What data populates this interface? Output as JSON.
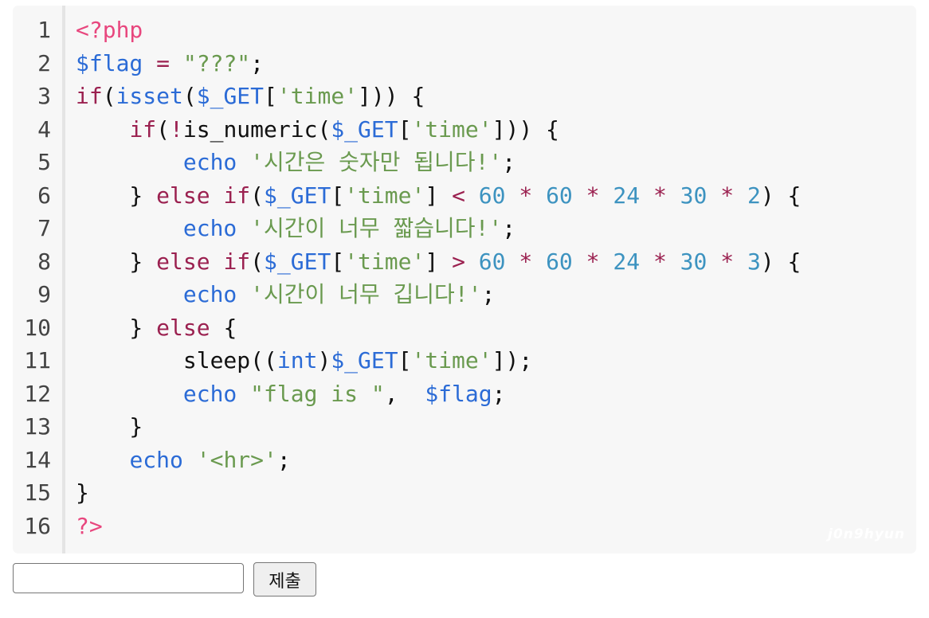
{
  "code": {
    "lines": [
      {
        "n": "1",
        "tokens": [
          {
            "c": "t-tag",
            "t": "<?php"
          }
        ]
      },
      {
        "n": "2",
        "tokens": [
          {
            "c": "t-var",
            "t": "$flag"
          },
          {
            "c": "t-plain",
            "t": " "
          },
          {
            "c": "t-op",
            "t": "="
          },
          {
            "c": "t-plain",
            "t": " "
          },
          {
            "c": "t-str",
            "t": "\"???\""
          },
          {
            "c": "t-plain",
            "t": ";"
          }
        ]
      },
      {
        "n": "3",
        "tokens": [
          {
            "c": "t-kw",
            "t": "if"
          },
          {
            "c": "t-plain",
            "t": "("
          },
          {
            "c": "t-fn",
            "t": "isset"
          },
          {
            "c": "t-plain",
            "t": "("
          },
          {
            "c": "t-var",
            "t": "$_GET"
          },
          {
            "c": "t-plain",
            "t": "["
          },
          {
            "c": "t-str",
            "t": "'time'"
          },
          {
            "c": "t-plain",
            "t": "])) {"
          }
        ]
      },
      {
        "n": "4",
        "tokens": [
          {
            "c": "t-plain",
            "t": "    "
          },
          {
            "c": "t-kw",
            "t": "if"
          },
          {
            "c": "t-plain",
            "t": "("
          },
          {
            "c": "t-op",
            "t": "!"
          },
          {
            "c": "t-plain",
            "t": "is_numeric("
          },
          {
            "c": "t-var",
            "t": "$_GET"
          },
          {
            "c": "t-plain",
            "t": "["
          },
          {
            "c": "t-str",
            "t": "'time'"
          },
          {
            "c": "t-plain",
            "t": "])) {"
          }
        ]
      },
      {
        "n": "5",
        "tokens": [
          {
            "c": "t-plain",
            "t": "        "
          },
          {
            "c": "t-fn",
            "t": "echo"
          },
          {
            "c": "t-plain",
            "t": " "
          },
          {
            "c": "t-str",
            "t": "'시간은 숫자만 됩니다!'"
          },
          {
            "c": "t-plain",
            "t": ";"
          }
        ]
      },
      {
        "n": "6",
        "tokens": [
          {
            "c": "t-plain",
            "t": "    } "
          },
          {
            "c": "t-kw",
            "t": "else"
          },
          {
            "c": "t-plain",
            "t": " "
          },
          {
            "c": "t-kw",
            "t": "if"
          },
          {
            "c": "t-plain",
            "t": "("
          },
          {
            "c": "t-var",
            "t": "$_GET"
          },
          {
            "c": "t-plain",
            "t": "["
          },
          {
            "c": "t-str",
            "t": "'time'"
          },
          {
            "c": "t-plain",
            "t": "] "
          },
          {
            "c": "t-op",
            "t": "<"
          },
          {
            "c": "t-plain",
            "t": " "
          },
          {
            "c": "t-num",
            "t": "60"
          },
          {
            "c": "t-plain",
            "t": " "
          },
          {
            "c": "t-op",
            "t": "*"
          },
          {
            "c": "t-plain",
            "t": " "
          },
          {
            "c": "t-num",
            "t": "60"
          },
          {
            "c": "t-plain",
            "t": " "
          },
          {
            "c": "t-op",
            "t": "*"
          },
          {
            "c": "t-plain",
            "t": " "
          },
          {
            "c": "t-num",
            "t": "24"
          },
          {
            "c": "t-plain",
            "t": " "
          },
          {
            "c": "t-op",
            "t": "*"
          },
          {
            "c": "t-plain",
            "t": " "
          },
          {
            "c": "t-num",
            "t": "30"
          },
          {
            "c": "t-plain",
            "t": " "
          },
          {
            "c": "t-op",
            "t": "*"
          },
          {
            "c": "t-plain",
            "t": " "
          },
          {
            "c": "t-num",
            "t": "2"
          },
          {
            "c": "t-plain",
            "t": ") {"
          }
        ]
      },
      {
        "n": "7",
        "tokens": [
          {
            "c": "t-plain",
            "t": "        "
          },
          {
            "c": "t-fn",
            "t": "echo"
          },
          {
            "c": "t-plain",
            "t": " "
          },
          {
            "c": "t-str",
            "t": "'시간이 너무 짧습니다!'"
          },
          {
            "c": "t-plain",
            "t": ";"
          }
        ]
      },
      {
        "n": "8",
        "tokens": [
          {
            "c": "t-plain",
            "t": "    } "
          },
          {
            "c": "t-kw",
            "t": "else"
          },
          {
            "c": "t-plain",
            "t": " "
          },
          {
            "c": "t-kw",
            "t": "if"
          },
          {
            "c": "t-plain",
            "t": "("
          },
          {
            "c": "t-var",
            "t": "$_GET"
          },
          {
            "c": "t-plain",
            "t": "["
          },
          {
            "c": "t-str",
            "t": "'time'"
          },
          {
            "c": "t-plain",
            "t": "] "
          },
          {
            "c": "t-op",
            "t": ">"
          },
          {
            "c": "t-plain",
            "t": " "
          },
          {
            "c": "t-num",
            "t": "60"
          },
          {
            "c": "t-plain",
            "t": " "
          },
          {
            "c": "t-op",
            "t": "*"
          },
          {
            "c": "t-plain",
            "t": " "
          },
          {
            "c": "t-num",
            "t": "60"
          },
          {
            "c": "t-plain",
            "t": " "
          },
          {
            "c": "t-op",
            "t": "*"
          },
          {
            "c": "t-plain",
            "t": " "
          },
          {
            "c": "t-num",
            "t": "24"
          },
          {
            "c": "t-plain",
            "t": " "
          },
          {
            "c": "t-op",
            "t": "*"
          },
          {
            "c": "t-plain",
            "t": " "
          },
          {
            "c": "t-num",
            "t": "30"
          },
          {
            "c": "t-plain",
            "t": " "
          },
          {
            "c": "t-op",
            "t": "*"
          },
          {
            "c": "t-plain",
            "t": " "
          },
          {
            "c": "t-num",
            "t": "3"
          },
          {
            "c": "t-plain",
            "t": ") {"
          }
        ]
      },
      {
        "n": "9",
        "tokens": [
          {
            "c": "t-plain",
            "t": "        "
          },
          {
            "c": "t-fn",
            "t": "echo"
          },
          {
            "c": "t-plain",
            "t": " "
          },
          {
            "c": "t-str",
            "t": "'시간이 너무 깁니다!'"
          },
          {
            "c": "t-plain",
            "t": ";"
          }
        ]
      },
      {
        "n": "10",
        "tokens": [
          {
            "c": "t-plain",
            "t": "    } "
          },
          {
            "c": "t-kw",
            "t": "else"
          },
          {
            "c": "t-plain",
            "t": " {"
          }
        ]
      },
      {
        "n": "11",
        "tokens": [
          {
            "c": "t-plain",
            "t": "        sleep(("
          },
          {
            "c": "t-fn",
            "t": "int"
          },
          {
            "c": "t-plain",
            "t": ")"
          },
          {
            "c": "t-var",
            "t": "$_GET"
          },
          {
            "c": "t-plain",
            "t": "["
          },
          {
            "c": "t-str",
            "t": "'time'"
          },
          {
            "c": "t-plain",
            "t": "]);"
          }
        ]
      },
      {
        "n": "12",
        "tokens": [
          {
            "c": "t-plain",
            "t": "        "
          },
          {
            "c": "t-fn",
            "t": "echo"
          },
          {
            "c": "t-plain",
            "t": " "
          },
          {
            "c": "t-str",
            "t": "\"flag is \""
          },
          {
            "c": "t-plain",
            "t": ",  "
          },
          {
            "c": "t-var",
            "t": "$flag"
          },
          {
            "c": "t-plain",
            "t": ";"
          }
        ]
      },
      {
        "n": "13",
        "tokens": [
          {
            "c": "t-plain",
            "t": "    }"
          }
        ]
      },
      {
        "n": "14",
        "tokens": [
          {
            "c": "t-plain",
            "t": "    "
          },
          {
            "c": "t-fn",
            "t": "echo"
          },
          {
            "c": "t-plain",
            "t": " "
          },
          {
            "c": "t-str",
            "t": "'<hr>'"
          },
          {
            "c": "t-plain",
            "t": ";"
          }
        ]
      },
      {
        "n": "15",
        "tokens": [
          {
            "c": "t-plain",
            "t": "}"
          }
        ]
      },
      {
        "n": "16",
        "tokens": [
          {
            "c": "t-tag",
            "t": "?>"
          }
        ]
      }
    ],
    "watermark": "j0n9hyun"
  },
  "form": {
    "input_value": "",
    "submit_label": "제출"
  },
  "colors": {
    "tag": "#e8477e",
    "variable": "#2b6bd6",
    "keyword": "#9b2150",
    "string": "#6a9a4f",
    "number": "#3d93c0",
    "background": "#f7f7f7"
  }
}
